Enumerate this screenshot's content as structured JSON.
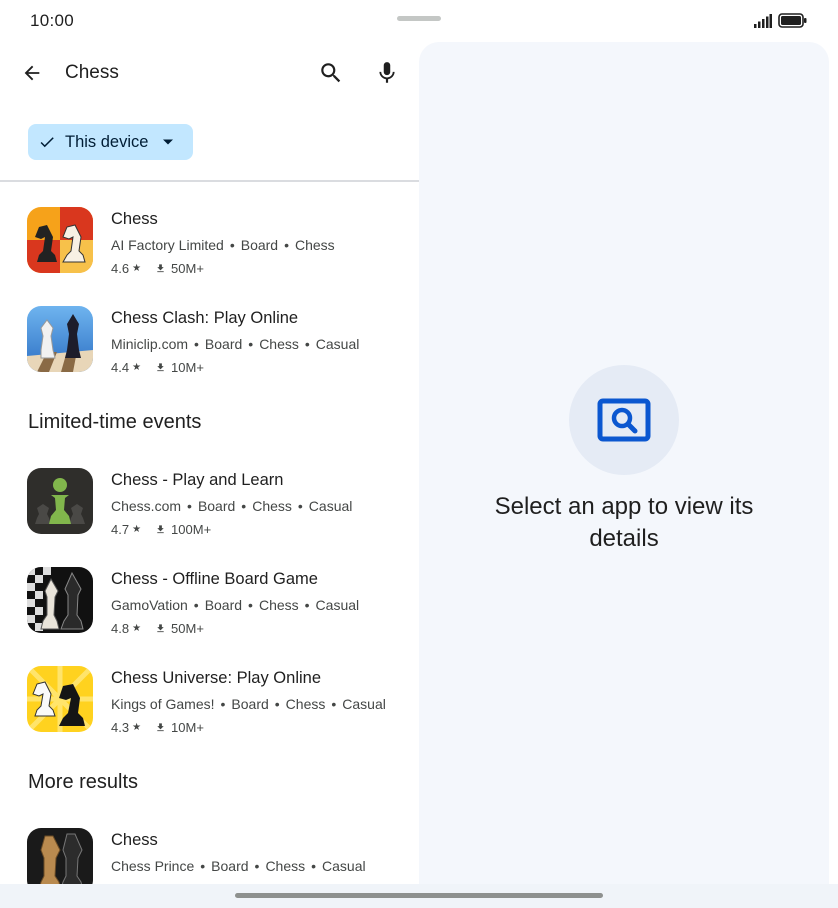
{
  "status_bar": {
    "time": "10:00"
  },
  "search": {
    "query": "Chess"
  },
  "filter": {
    "label": "This device"
  },
  "results": {
    "top": [
      {
        "title": "Chess",
        "developer": "AI Factory Limited",
        "tags": [
          "Board",
          "Chess"
        ],
        "rating": "4.6",
        "downloads": "50M+"
      },
      {
        "title": "Chess Clash: Play Online",
        "developer": "Miniclip.com",
        "tags": [
          "Board",
          "Chess",
          "Casual"
        ],
        "rating": "4.4",
        "downloads": "10M+"
      }
    ],
    "limited_header": "Limited-time events",
    "limited": [
      {
        "title": "Chess - Play and Learn",
        "developer": "Chess.com",
        "tags": [
          "Board",
          "Chess",
          "Casual"
        ],
        "rating": "4.7",
        "downloads": "100M+"
      },
      {
        "title": "Chess - Offline Board Game",
        "developer": "GamoVation",
        "tags": [
          "Board",
          "Chess",
          "Casual"
        ],
        "rating": "4.8",
        "downloads": "50M+"
      },
      {
        "title": "Chess Universe: Play Online",
        "developer": "Kings of Games!",
        "tags": [
          "Board",
          "Chess",
          "Casual"
        ],
        "rating": "4.3",
        "downloads": "10M+"
      }
    ],
    "more_header": "More results",
    "more": [
      {
        "title": "Chess",
        "developer": "Chess Prince",
        "tags": [
          "Board",
          "Chess",
          "Casual"
        ],
        "rating": "",
        "downloads": ""
      }
    ]
  },
  "detail_pane": {
    "empty_message": "Select an app to view its details"
  },
  "colors": {
    "chip_bg": "#c2e7ff",
    "accent_blue": "#0b57d0",
    "pane_bg": "#f4f7fc"
  },
  "icons": [
    "arrow-back-icon",
    "search-icon",
    "mic-icon",
    "check-icon",
    "dropdown-caret-icon",
    "star-icon",
    "download-icon",
    "app-search-icon",
    "signal-icon",
    "battery-icon"
  ]
}
